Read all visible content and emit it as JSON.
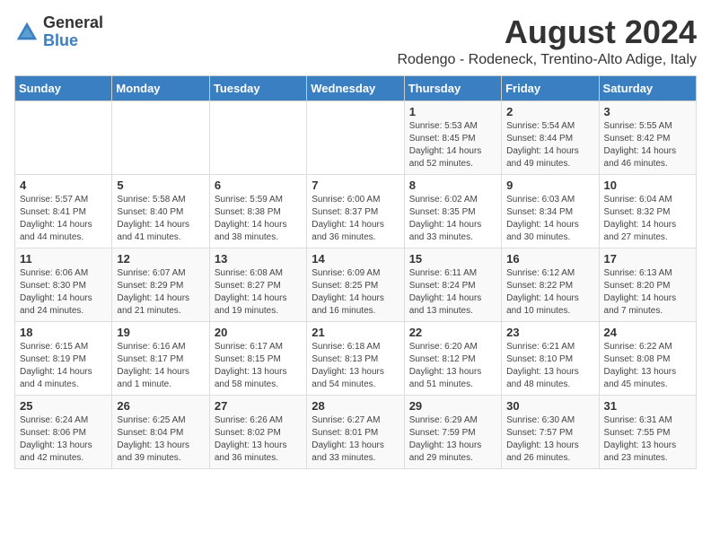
{
  "logo": {
    "general": "General",
    "blue": "Blue"
  },
  "title": "August 2024",
  "location": "Rodengo - Rodeneck, Trentino-Alto Adige, Italy",
  "headers": [
    "Sunday",
    "Monday",
    "Tuesday",
    "Wednesday",
    "Thursday",
    "Friday",
    "Saturday"
  ],
  "weeks": [
    [
      {
        "day": "",
        "text": ""
      },
      {
        "day": "",
        "text": ""
      },
      {
        "day": "",
        "text": ""
      },
      {
        "day": "",
        "text": ""
      },
      {
        "day": "1",
        "text": "Sunrise: 5:53 AM\nSunset: 8:45 PM\nDaylight: 14 hours and 52 minutes."
      },
      {
        "day": "2",
        "text": "Sunrise: 5:54 AM\nSunset: 8:44 PM\nDaylight: 14 hours and 49 minutes."
      },
      {
        "day": "3",
        "text": "Sunrise: 5:55 AM\nSunset: 8:42 PM\nDaylight: 14 hours and 46 minutes."
      }
    ],
    [
      {
        "day": "4",
        "text": "Sunrise: 5:57 AM\nSunset: 8:41 PM\nDaylight: 14 hours and 44 minutes."
      },
      {
        "day": "5",
        "text": "Sunrise: 5:58 AM\nSunset: 8:40 PM\nDaylight: 14 hours and 41 minutes."
      },
      {
        "day": "6",
        "text": "Sunrise: 5:59 AM\nSunset: 8:38 PM\nDaylight: 14 hours and 38 minutes."
      },
      {
        "day": "7",
        "text": "Sunrise: 6:00 AM\nSunset: 8:37 PM\nDaylight: 14 hours and 36 minutes."
      },
      {
        "day": "8",
        "text": "Sunrise: 6:02 AM\nSunset: 8:35 PM\nDaylight: 14 hours and 33 minutes."
      },
      {
        "day": "9",
        "text": "Sunrise: 6:03 AM\nSunset: 8:34 PM\nDaylight: 14 hours and 30 minutes."
      },
      {
        "day": "10",
        "text": "Sunrise: 6:04 AM\nSunset: 8:32 PM\nDaylight: 14 hours and 27 minutes."
      }
    ],
    [
      {
        "day": "11",
        "text": "Sunrise: 6:06 AM\nSunset: 8:30 PM\nDaylight: 14 hours and 24 minutes."
      },
      {
        "day": "12",
        "text": "Sunrise: 6:07 AM\nSunset: 8:29 PM\nDaylight: 14 hours and 21 minutes."
      },
      {
        "day": "13",
        "text": "Sunrise: 6:08 AM\nSunset: 8:27 PM\nDaylight: 14 hours and 19 minutes."
      },
      {
        "day": "14",
        "text": "Sunrise: 6:09 AM\nSunset: 8:25 PM\nDaylight: 14 hours and 16 minutes."
      },
      {
        "day": "15",
        "text": "Sunrise: 6:11 AM\nSunset: 8:24 PM\nDaylight: 14 hours and 13 minutes."
      },
      {
        "day": "16",
        "text": "Sunrise: 6:12 AM\nSunset: 8:22 PM\nDaylight: 14 hours and 10 minutes."
      },
      {
        "day": "17",
        "text": "Sunrise: 6:13 AM\nSunset: 8:20 PM\nDaylight: 14 hours and 7 minutes."
      }
    ],
    [
      {
        "day": "18",
        "text": "Sunrise: 6:15 AM\nSunset: 8:19 PM\nDaylight: 14 hours and 4 minutes."
      },
      {
        "day": "19",
        "text": "Sunrise: 6:16 AM\nSunset: 8:17 PM\nDaylight: 14 hours and 1 minute."
      },
      {
        "day": "20",
        "text": "Sunrise: 6:17 AM\nSunset: 8:15 PM\nDaylight: 13 hours and 58 minutes."
      },
      {
        "day": "21",
        "text": "Sunrise: 6:18 AM\nSunset: 8:13 PM\nDaylight: 13 hours and 54 minutes."
      },
      {
        "day": "22",
        "text": "Sunrise: 6:20 AM\nSunset: 8:12 PM\nDaylight: 13 hours and 51 minutes."
      },
      {
        "day": "23",
        "text": "Sunrise: 6:21 AM\nSunset: 8:10 PM\nDaylight: 13 hours and 48 minutes."
      },
      {
        "day": "24",
        "text": "Sunrise: 6:22 AM\nSunset: 8:08 PM\nDaylight: 13 hours and 45 minutes."
      }
    ],
    [
      {
        "day": "25",
        "text": "Sunrise: 6:24 AM\nSunset: 8:06 PM\nDaylight: 13 hours and 42 minutes."
      },
      {
        "day": "26",
        "text": "Sunrise: 6:25 AM\nSunset: 8:04 PM\nDaylight: 13 hours and 39 minutes."
      },
      {
        "day": "27",
        "text": "Sunrise: 6:26 AM\nSunset: 8:02 PM\nDaylight: 13 hours and 36 minutes."
      },
      {
        "day": "28",
        "text": "Sunrise: 6:27 AM\nSunset: 8:01 PM\nDaylight: 13 hours and 33 minutes."
      },
      {
        "day": "29",
        "text": "Sunrise: 6:29 AM\nSunset: 7:59 PM\nDaylight: 13 hours and 29 minutes."
      },
      {
        "day": "30",
        "text": "Sunrise: 6:30 AM\nSunset: 7:57 PM\nDaylight: 13 hours and 26 minutes."
      },
      {
        "day": "31",
        "text": "Sunrise: 6:31 AM\nSunset: 7:55 PM\nDaylight: 13 hours and 23 minutes."
      }
    ]
  ]
}
